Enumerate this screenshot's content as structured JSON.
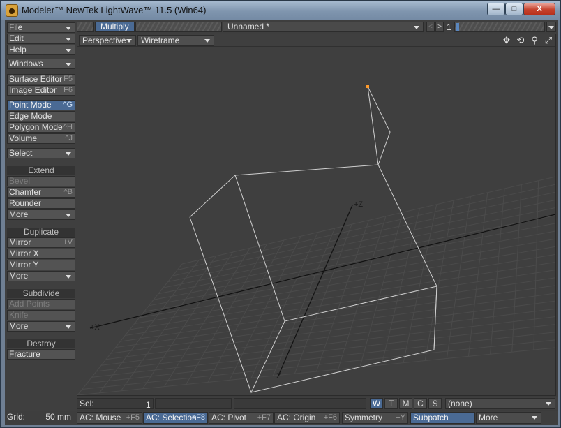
{
  "window": {
    "title": "Modeler™ NewTek LightWave™ 11.5 (Win64)",
    "minimize": "—",
    "maximize": "□",
    "close": "X"
  },
  "sidebar": {
    "menus": [
      {
        "label": "File"
      },
      {
        "label": "Edit"
      },
      {
        "label": "Help"
      },
      {
        "label": "Windows"
      }
    ],
    "editors": [
      {
        "label": "Surface Editor",
        "shortcut": "F5"
      },
      {
        "label": "Image Editor",
        "shortcut": "F6"
      }
    ],
    "modes": [
      {
        "label": "Point Mode",
        "shortcut": "^G",
        "selected": true
      },
      {
        "label": "Edge Mode",
        "shortcut": ""
      },
      {
        "label": "Polygon Mode",
        "shortcut": "^H"
      },
      {
        "label": "Volume",
        "shortcut": "^J"
      }
    ],
    "select": {
      "label": "Select"
    },
    "extend": {
      "header": "Extend",
      "items": [
        {
          "label": "Bevel",
          "shortcut": "",
          "disabled": true
        },
        {
          "label": "Chamfer",
          "shortcut": "^B"
        },
        {
          "label": "Rounder",
          "shortcut": ""
        },
        {
          "label": "More",
          "dropdown": true
        }
      ]
    },
    "duplicate": {
      "header": "Duplicate",
      "items": [
        {
          "label": "Mirror",
          "shortcut": "+V"
        },
        {
          "label": "Mirror X",
          "shortcut": ""
        },
        {
          "label": "Mirror Y",
          "shortcut": ""
        },
        {
          "label": "More",
          "dropdown": true
        }
      ]
    },
    "subdivide": {
      "header": "Subdivide",
      "items": [
        {
          "label": "Add Points",
          "disabled": true
        },
        {
          "label": "Knife",
          "disabled": true
        },
        {
          "label": "More",
          "dropdown": true
        }
      ]
    },
    "destroy": {
      "header": "Destroy",
      "items": [
        {
          "label": "Fracture"
        }
      ]
    }
  },
  "toolbar": {
    "tab_label": "Multiply",
    "document": "Unnamed *",
    "layer_number": "1",
    "prev": "<",
    "next": ">"
  },
  "viewport": {
    "projection": "Perspective",
    "render_mode": "Wireframe",
    "icons": [
      "move-view-icon",
      "rotate-view-icon",
      "zoom-view-icon",
      "maximize-view-icon"
    ],
    "axis_labels": {
      "x": "+X",
      "z_top": "+Z",
      "z_bottom": "Z"
    }
  },
  "infobar": {
    "sel_label": "Sel:",
    "sel_value": "1",
    "wtmcs": [
      {
        "label": "W",
        "active": true
      },
      {
        "label": "T",
        "active": false
      },
      {
        "label": "M",
        "active": false
      },
      {
        "label": "C",
        "active": false
      },
      {
        "label": "S",
        "active": false
      }
    ],
    "symmetry_select": "(none)"
  },
  "statusbar": {
    "grid_label": "Grid:",
    "grid_value": "50 mm",
    "items": [
      {
        "label": "AC: Mouse",
        "shortcut": "+F5",
        "active": false
      },
      {
        "label": "AC: Selection",
        "shortcut": "+F8",
        "active": true
      },
      {
        "label": "AC: Pivot",
        "shortcut": "+F7",
        "active": false
      },
      {
        "label": "AC: Origin",
        "shortcut": "+F6",
        "active": false
      },
      {
        "label": "Symmetry",
        "shortcut": "+Y",
        "active": false
      },
      {
        "label": "Subpatch",
        "shortcut": "",
        "active": true
      },
      {
        "label": "More",
        "shortcut": "",
        "active": false,
        "dropdown": true
      }
    ]
  },
  "colors": {
    "accent": "#4a6a94",
    "selected_point": "#ff9a2a",
    "grid_line": "#4b4b4b",
    "wire": "#cfcfcf"
  }
}
